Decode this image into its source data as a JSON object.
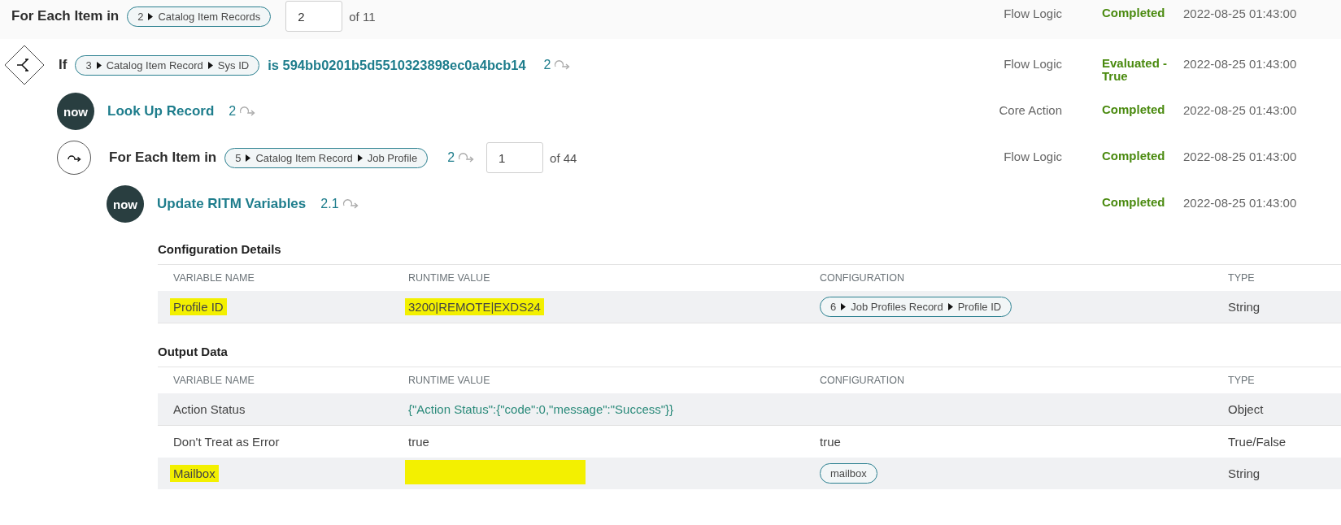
{
  "steps": [
    {
      "kind": "loop",
      "selected": true,
      "title": "For Each Item in",
      "pill": {
        "number": "2",
        "path": [
          "Catalog Item Records"
        ]
      },
      "counter": {
        "value": "2",
        "total": "of 11"
      },
      "type": "Flow Logic",
      "status": "Completed",
      "timestamp": "2022-08-25 01:43:00"
    },
    {
      "kind": "if",
      "selected": false,
      "title": "If",
      "pill": {
        "number": "3",
        "path": [
          "Catalog Item Record",
          "Sys ID"
        ]
      },
      "condition": "is 594bb0201b5d5510323898ec0a4bcb14",
      "count": "2",
      "type": "Flow Logic",
      "status": "Evaluated - True",
      "timestamp": "2022-08-25 01:43:00",
      "children": [
        {
          "kind": "action",
          "logo_text": "now",
          "selected": false,
          "title": "Look Up Record",
          "count": "2",
          "type": "Core Action",
          "status": "Completed",
          "timestamp": "2022-08-25 01:43:00"
        },
        {
          "kind": "loop",
          "selected": false,
          "title": "For Each Item in",
          "pill": {
            "number": "5",
            "path": [
              "Catalog Item Record",
              "Job Profile"
            ]
          },
          "count": "2",
          "counter": {
            "value": "1",
            "total": "of 44"
          },
          "type": "Flow Logic",
          "status": "Completed",
          "timestamp": "2022-08-25 01:43:00",
          "children": [
            {
              "kind": "action",
              "logo_text": "now",
              "selected": false,
              "title": "Update RITM Variables",
              "count": "2.1",
              "status": "Completed",
              "timestamp": "2022-08-25 01:43:00",
              "details": [
                {
                  "title": "Configuration Details",
                  "columns": [
                    "VARIABLE NAME",
                    "RUNTIME VALUE",
                    "CONFIGURATION",
                    "TYPE"
                  ],
                  "rows": [
                    {
                      "cells": [
                        {
                          "kind": "text",
                          "text": "Profile ID",
                          "highlighted": true
                        },
                        {
                          "kind": "text",
                          "text": "3200|REMOTE|EXDS24",
                          "highlighted": true
                        },
                        {
                          "kind": "pill",
                          "number": "6",
                          "path": [
                            "Job Profiles Record",
                            "Profile ID"
                          ],
                          "highlighted": false
                        },
                        {
                          "kind": "text",
                          "text": "String",
                          "highlighted": false
                        }
                      ]
                    }
                  ]
                },
                {
                  "title": "Output Data",
                  "columns": [
                    "VARIABLE NAME",
                    "RUNTIME VALUE",
                    "CONFIGURATION",
                    "TYPE"
                  ],
                  "rows": [
                    {
                      "cells": [
                        {
                          "kind": "text",
                          "text": "Action Status",
                          "highlighted": false
                        },
                        {
                          "kind": "json",
                          "text": "{\"Action Status\":{\"code\":0,\"message\":\"Success\"}}",
                          "highlighted": false
                        },
                        {
                          "kind": "empty"
                        },
                        {
                          "kind": "text",
                          "text": "Object",
                          "highlighted": false
                        }
                      ]
                    },
                    {
                      "cells": [
                        {
                          "kind": "text",
                          "text": "Don't Treat as Error",
                          "highlighted": false
                        },
                        {
                          "kind": "text",
                          "text": "true",
                          "highlighted": false
                        },
                        {
                          "kind": "text",
                          "text": "true",
                          "highlighted": false
                        },
                        {
                          "kind": "text",
                          "text": "True/False",
                          "highlighted": false
                        }
                      ]
                    },
                    {
                      "cells": [
                        {
                          "kind": "text",
                          "text": "Mailbox",
                          "highlighted": true
                        },
                        {
                          "kind": "redacted",
                          "highlighted": true
                        },
                        {
                          "kind": "pill",
                          "path": [
                            "mailbox"
                          ],
                          "highlighted": false
                        },
                        {
                          "kind": "text",
                          "text": "String",
                          "highlighted": false
                        }
                      ]
                    }
                  ]
                }
              ]
            }
          ]
        }
      ]
    }
  ]
}
